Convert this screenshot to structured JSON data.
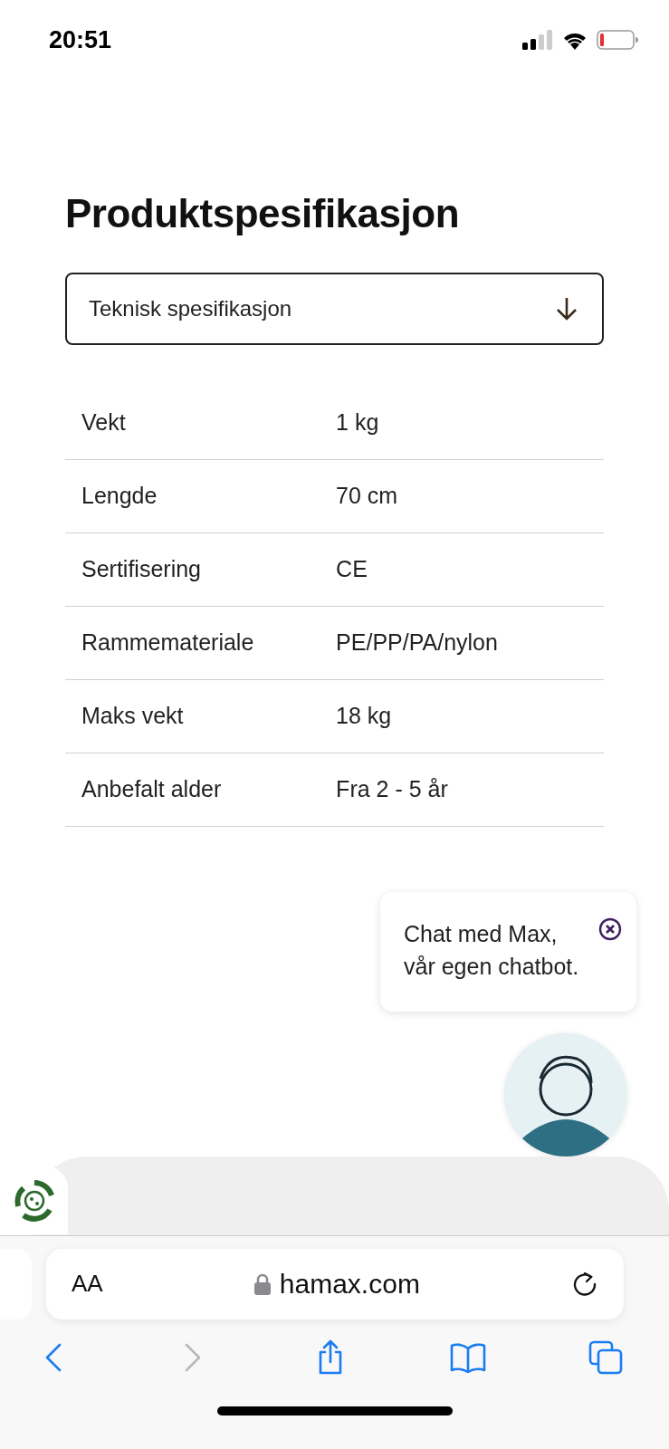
{
  "status_bar": {
    "time": "20:51"
  },
  "page": {
    "title": "Produktspesifikasjon",
    "dropdown": {
      "value": "Teknisk spesifikasjon",
      "expanded": false
    },
    "specs": [
      {
        "label": "Vekt",
        "value": "1 kg"
      },
      {
        "label": "Lengde",
        "value": "70 cm"
      },
      {
        "label": "Sertifisering",
        "value": "CE"
      },
      {
        "label": "Rammemateriale",
        "value": "PE/PP/PA/nylon"
      },
      {
        "label": "Maks vekt",
        "value": "18 kg"
      },
      {
        "label": "Anbefalt alder",
        "value": "Fra 2 - 5 år"
      }
    ]
  },
  "chat": {
    "lines": [
      "Chat med Max,",
      "vår egen chatbot."
    ]
  },
  "browser": {
    "text_size_button": "AA",
    "url": "hamax.com",
    "toolbar": [
      {
        "kind": "back",
        "disabled": false
      },
      {
        "kind": "forward",
        "disabled": true
      },
      {
        "kind": "share",
        "disabled": false
      },
      {
        "kind": "bookmarks",
        "disabled": false
      },
      {
        "kind": "tabs",
        "disabled": false
      }
    ]
  }
}
